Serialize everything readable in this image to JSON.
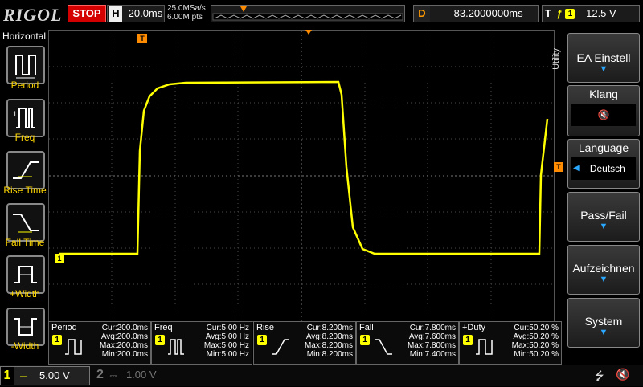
{
  "topbar": {
    "logo": "RIGOL",
    "status": "STOP",
    "timebase_label": "H",
    "timebase_value": "20.0ms",
    "sample_rate": "25.0MSa/s",
    "memory_depth": "6.00M pts",
    "delay_label": "D",
    "delay_value": "83.2000000ms",
    "trigger_label": "T",
    "trigger_source": "1",
    "trigger_level": "12.5 V"
  },
  "left_panel": {
    "title": "Horizontal",
    "items": [
      {
        "label": "Period",
        "icon": "period-icon"
      },
      {
        "label": "Freq",
        "icon": "freq-icon"
      },
      {
        "label": "Rise Time",
        "icon": "rise-time-icon"
      },
      {
        "label": "Fall Time",
        "icon": "fall-time-icon"
      },
      {
        "label": "+Width",
        "icon": "pos-width-icon"
      },
      {
        "label": "-Width",
        "icon": "neg-width-icon"
      }
    ]
  },
  "right_panel": {
    "side_label": "Utility",
    "buttons": [
      {
        "label": "EA Einstell",
        "has_arrow": true
      },
      {
        "label": "Klang",
        "value": "🔇"
      },
      {
        "label": "Language",
        "value": "Deutsch"
      },
      {
        "label": "Pass/Fail",
        "has_arrow": true
      },
      {
        "label": "Aufzeichnen",
        "has_arrow": true
      },
      {
        "label": "System",
        "has_arrow": true
      }
    ]
  },
  "markers": {
    "trigger_pos": "T",
    "channel_ground": "1",
    "trigger_level_marker": "T"
  },
  "measurements": [
    {
      "name": "Period",
      "channel": "1",
      "cur": "Cur:200.0ms",
      "avg": "Avg:200.0ms",
      "max": "Max:200.0ms",
      "min": "Min:200.0ms"
    },
    {
      "name": "Freq",
      "channel": "1",
      "cur": "Cur:5.00 Hz",
      "avg": "Avg:5.00 Hz",
      "max": "Max:5.00 Hz",
      "min": "Min:5.00 Hz"
    },
    {
      "name": "Rise",
      "channel": "1",
      "cur": "Cur:8.200ms",
      "avg": "Avg:8.200ms",
      "max": "Max:8.200ms",
      "min": "Min:8.200ms"
    },
    {
      "name": "Fall",
      "channel": "1",
      "cur": "Cur:7.800ms",
      "avg": "Avg:7.600ms",
      "max": "Max:7.800ms",
      "min": "Min:7.400ms"
    },
    {
      "name": "+Duty",
      "channel": "1",
      "cur": "Cur:50.20 %",
      "avg": "Avg:50.20 %",
      "max": "Max:50.20 %",
      "min": "Min:50.20 %"
    }
  ],
  "bottom": {
    "ch1_num": "1",
    "ch1_scale": "5.00 V",
    "ch2_num": "2",
    "ch2_scale": "1.00 V"
  },
  "colors": {
    "trace": "#ffff00",
    "stop": "#d40000",
    "accent": "#2aa7ff",
    "marker": "#ff8c00"
  }
}
